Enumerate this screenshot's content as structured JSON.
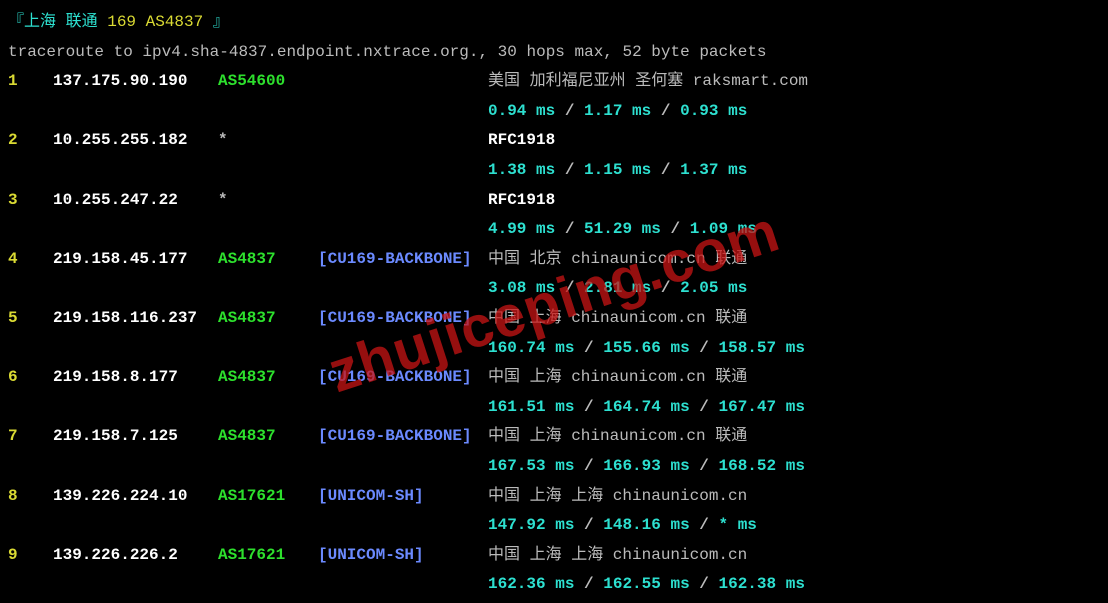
{
  "header": {
    "prefix": "『上海  联通 ",
    "asn_text": "169  AS4837",
    "suffix": " 』"
  },
  "cmd": "traceroute to ipv4.sha-4837.endpoint.nxtrace.org., 30 hops max, 52 byte packets",
  "hops": [
    {
      "n": "1",
      "ip": "137.175.90.190",
      "asn": "AS54600",
      "tag": "",
      "geo": "美国  加利福尼亚州  圣何塞   raksmart.com",
      "t": [
        "0.94 ms",
        "1.17 ms",
        "0.93 ms"
      ],
      "rfc": false
    },
    {
      "n": "2",
      "ip": "10.255.255.182",
      "asn": "*",
      "tag": "",
      "geo": "RFC1918",
      "t": [
        "1.38 ms",
        "1.15 ms",
        "1.37 ms"
      ],
      "rfc": true
    },
    {
      "n": "3",
      "ip": "10.255.247.22",
      "asn": "*",
      "tag": "",
      "geo": "RFC1918",
      "t": [
        "4.99 ms",
        "51.29 ms",
        "1.09 ms"
      ],
      "rfc": true
    },
    {
      "n": "4",
      "ip": "219.158.45.177",
      "asn": "AS4837",
      "tag": "[CU169-BACKBONE]",
      "geo": "中国  北京    chinaunicom.cn   联通",
      "t": [
        "3.08 ms",
        "2.81 ms",
        "2.05 ms"
      ],
      "rfc": false
    },
    {
      "n": "5",
      "ip": "219.158.116.237",
      "asn": "AS4837",
      "tag": "[CU169-BACKBONE]",
      "geo": "中国  上海    chinaunicom.cn   联通",
      "t": [
        "160.74 ms",
        "155.66 ms",
        "158.57 ms"
      ],
      "rfc": false
    },
    {
      "n": "6",
      "ip": "219.158.8.177",
      "asn": "AS4837",
      "tag": "[CU169-BACKBONE]",
      "geo": "中国  上海    chinaunicom.cn   联通",
      "t": [
        "161.51 ms",
        "164.74 ms",
        "167.47 ms"
      ],
      "rfc": false
    },
    {
      "n": "7",
      "ip": "219.158.7.125",
      "asn": "AS4837",
      "tag": "[CU169-BACKBONE]",
      "geo": "中国  上海    chinaunicom.cn   联通",
      "t": [
        "167.53 ms",
        "166.93 ms",
        "168.52 ms"
      ],
      "rfc": false
    },
    {
      "n": "8",
      "ip": "139.226.224.10",
      "asn": "AS17621",
      "tag": "[UNICOM-SH]",
      "geo": "中国  上海  上海    chinaunicom.cn",
      "t": [
        "147.92 ms",
        "148.16 ms",
        "* ms"
      ],
      "rfc": false
    },
    {
      "n": "9",
      "ip": "139.226.226.2",
      "asn": "AS17621",
      "tag": "[UNICOM-SH]",
      "geo": "中国  上海  上海    chinaunicom.cn",
      "t": [
        "162.36 ms",
        "162.55 ms",
        "162.38 ms"
      ],
      "rfc": false
    }
  ],
  "watermark": "zhujiceping.com"
}
